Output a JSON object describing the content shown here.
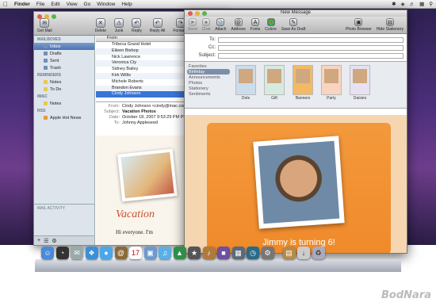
{
  "menubar": {
    "app": "Finder",
    "items": [
      "File",
      "Edit",
      "View",
      "Go",
      "Window",
      "Help"
    ]
  },
  "mail": {
    "toolbar": [
      "Delete",
      "Junk",
      "Reply",
      "Reply All",
      "Forward"
    ],
    "get_mail": "Get Mail",
    "sidebar": {
      "mailboxes_head": "MAILBOXES",
      "mailboxes": [
        "Inbox",
        "Drafts",
        "Sent",
        "Trash"
      ],
      "reminders_head": "REMINDERS",
      "reminders": [
        "Notes",
        "To Do"
      ],
      "imac_head": "IMAC",
      "imac": [
        "Notes"
      ],
      "rss_head": "RSS",
      "rss": [
        "Apple Hot News"
      ],
      "activity": "MAIL ACTIVITY"
    },
    "list_header": "From",
    "list": [
      "Tribeca Grand Hotel",
      "Eileen Bishop",
      "Nick Lawrence",
      "Veronica Cty",
      "Sidney Bailey",
      "Kirk Willis",
      "Michele Roberts",
      "Brandon Evans",
      "Cindy Johnson"
    ],
    "selected_index": 8,
    "meta": {
      "from_k": "From:",
      "from_v": "Cindy Johnson <cindy@mac.com>",
      "subject_k": "Subject:",
      "subject_v": "Vacation Photos",
      "date_k": "Date:",
      "date_v": "October 18, 2007 9:53:29 PM PDT",
      "to_k": "To:",
      "to_v": "Johnny Appleseed"
    },
    "body_title": "Vacation",
    "body_greeting": "Hi everyone. I'm"
  },
  "new_message": {
    "title": "New Message",
    "toolbar": [
      "Send",
      "Chat",
      "Attach",
      "Address",
      "Fonts",
      "Colors",
      "Save As Draft",
      "Photo Browser",
      "Hide Stationery"
    ],
    "fields": {
      "to": "To:",
      "cc": "Cc:",
      "subject": "Subject:"
    },
    "categories": [
      "Favorites",
      "Birthday",
      "Announcements",
      "Photos",
      "Stationery",
      "Sentiments"
    ],
    "selected_category": 1,
    "thumbnails": [
      "Dots",
      "Gift",
      "Banners",
      "Party",
      "Daisies"
    ],
    "card_text": "Jimmy is turning 6!"
  },
  "watermark": "BodNara"
}
